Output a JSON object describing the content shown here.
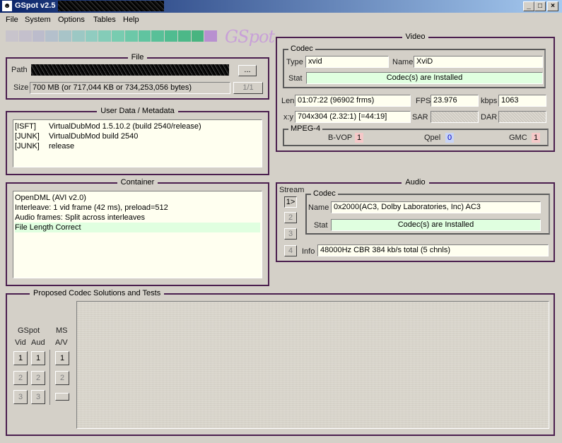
{
  "window": {
    "title": "GSpot v2.5 ß8:",
    "min": "_",
    "max": "□",
    "close": "×"
  },
  "menu": [
    "File",
    "System",
    "Options",
    "Tables",
    "Help"
  ],
  "logo": {
    "text": "GSpot",
    "gradient": [
      "#c8c4cc",
      "#c4c0cc",
      "#bcbccc",
      "#b4c0cc",
      "#a8c4c8",
      "#9cc8c4",
      "#90ccc0",
      "#84ccb8",
      "#78ccb0",
      "#6cc8a8",
      "#60c4a0",
      "#58c098",
      "#50bc90",
      "#4cb888",
      "#48b480"
    ]
  },
  "file": {
    "title": "File",
    "path_label": "Path",
    "browse": "...",
    "size_label": "Size",
    "size_value": "700 MB (or 717,044 KB or 734,253,056 bytes)",
    "counter": "1/1"
  },
  "userdata": {
    "title": "User Data / Metadata",
    "rows": [
      {
        "tag": "[ISFT]",
        "value": "VirtualDubMod 1.5.10.2 (build 2540/release)"
      },
      {
        "tag": "[JUNK]",
        "value": "VirtualDubMod build 2540"
      },
      {
        "tag": "[JUNK]",
        "value": "release"
      }
    ]
  },
  "container": {
    "title": "Container",
    "rows": [
      "OpenDML (AVI v2.0)",
      "Interleave: 1 vid frame (42 ms), preload=512",
      "Audio frames: Split across interleaves",
      "File Length Correct"
    ]
  },
  "video": {
    "title": "Video",
    "codec_title": "Codec",
    "type_label": "Type",
    "type_value": "xvid",
    "name_label": "Name",
    "name_value": "XviD",
    "stat_label": "Stat",
    "stat_value": "Codec(s) are Installed",
    "len_label": "Len",
    "len_value": "01:07:22 (96902 frms)",
    "fps_label": "FPS",
    "fps_value": "23.976",
    "kbps_label": "kbps",
    "kbps_value": "1063",
    "xy_label": "x:y",
    "xy_value": "704x304 (2.32:1) [=44:19]",
    "sar_label": "SAR",
    "dar_label": "DAR",
    "mpeg4_title": "MPEG-4",
    "bvop_label": "B-VOP",
    "bvop_value": "1",
    "qpel_label": "Qpel",
    "qpel_value": "0",
    "gmc_label": "GMC",
    "gmc_value": "1"
  },
  "audio": {
    "title": "Audio",
    "stream_label": "Stream",
    "streams": [
      "1>",
      "2",
      "3",
      "4"
    ],
    "codec_title": "Codec",
    "name_label": "Name",
    "name_value": "0x2000(AC3, Dolby Laboratories, Inc) AC3",
    "stat_label": "Stat",
    "stat_value": "Codec(s) are Installed",
    "info_label": "Info",
    "info_value": "48000Hz CBR 384 kb/s total (5 chnls)"
  },
  "proposed": {
    "title": "Proposed Codec Solutions and Tests",
    "gspot_label": "GSpot",
    "ms_label": "MS",
    "vid_label": "Vid",
    "aud_label": "Aud",
    "av_label": "A/V",
    "buttons": [
      "1",
      "2",
      "3"
    ]
  }
}
